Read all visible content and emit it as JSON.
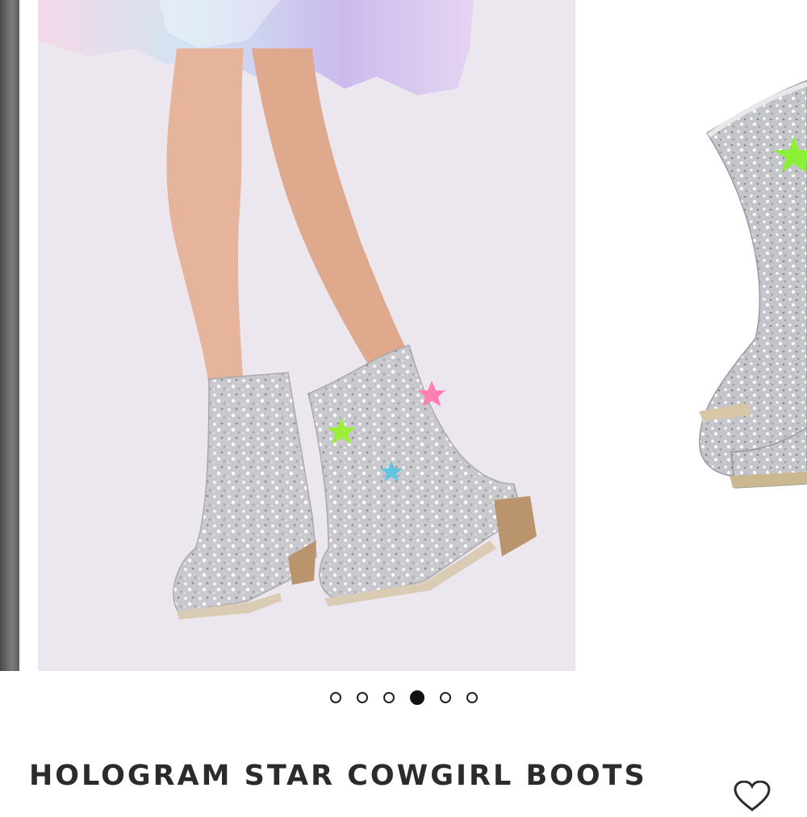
{
  "gallery": {
    "images": [
      {
        "alt": "hologram-boots-side-view"
      },
      {
        "alt": "hologram-boots-on-model"
      },
      {
        "alt": "hologram-boots-product-shot"
      }
    ],
    "dots": [
      {
        "active": false
      },
      {
        "active": false
      },
      {
        "active": false
      },
      {
        "active": true
      },
      {
        "active": false
      },
      {
        "active": false
      }
    ]
  },
  "product": {
    "title": "HOLOGRAM STAR COWGIRL BOOTS"
  },
  "icons": {
    "wishlist": "heart-outline-icon"
  },
  "colors": {
    "text": "#2b2b2b",
    "dot_active": "#111111",
    "photo_background": "#ece7ef"
  }
}
